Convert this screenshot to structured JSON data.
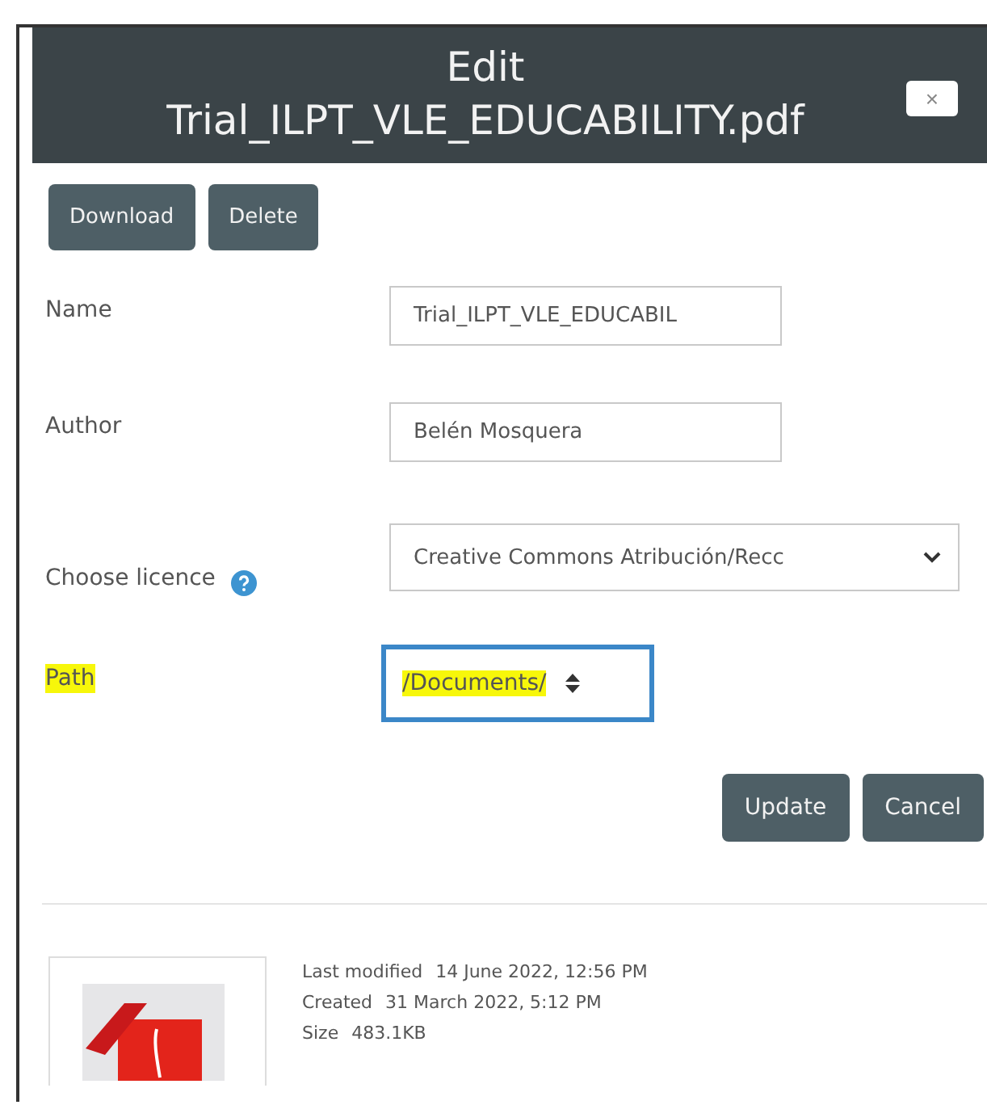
{
  "dialog": {
    "title_lines": [
      "Edit",
      "Trial_ILPT_VLE_EDUCABILITY.pdf"
    ],
    "close": "×"
  },
  "actions": [
    "Download",
    "Delete"
  ],
  "fields": [
    {
      "kind": "text",
      "label": "Name",
      "value": "Trial_ILPT_VLE_EDUCABIL",
      "highlighted": false,
      "help": false,
      "focused": false
    },
    {
      "kind": "text",
      "label": "Author",
      "value": "Belén Mosquera",
      "highlighted": false,
      "help": false,
      "focused": false
    },
    {
      "kind": "select",
      "label": "Choose licence",
      "value": "Creative Commons Atribución/Recc",
      "highlighted": false,
      "help": true,
      "focused": false
    },
    {
      "kind": "path",
      "label": "Path",
      "value": "/Documents/",
      "highlighted": true,
      "help": false,
      "focused": true
    }
  ],
  "buttons": [
    "Update",
    "Cancel"
  ],
  "file_info": [
    {
      "label": "Last modified",
      "value": "14 June 2022, 12:56 PM"
    },
    {
      "label": "Created",
      "value": "31 March 2022, 5:12 PM"
    },
    {
      "label": "Size",
      "value": "483.1KB"
    }
  ]
}
